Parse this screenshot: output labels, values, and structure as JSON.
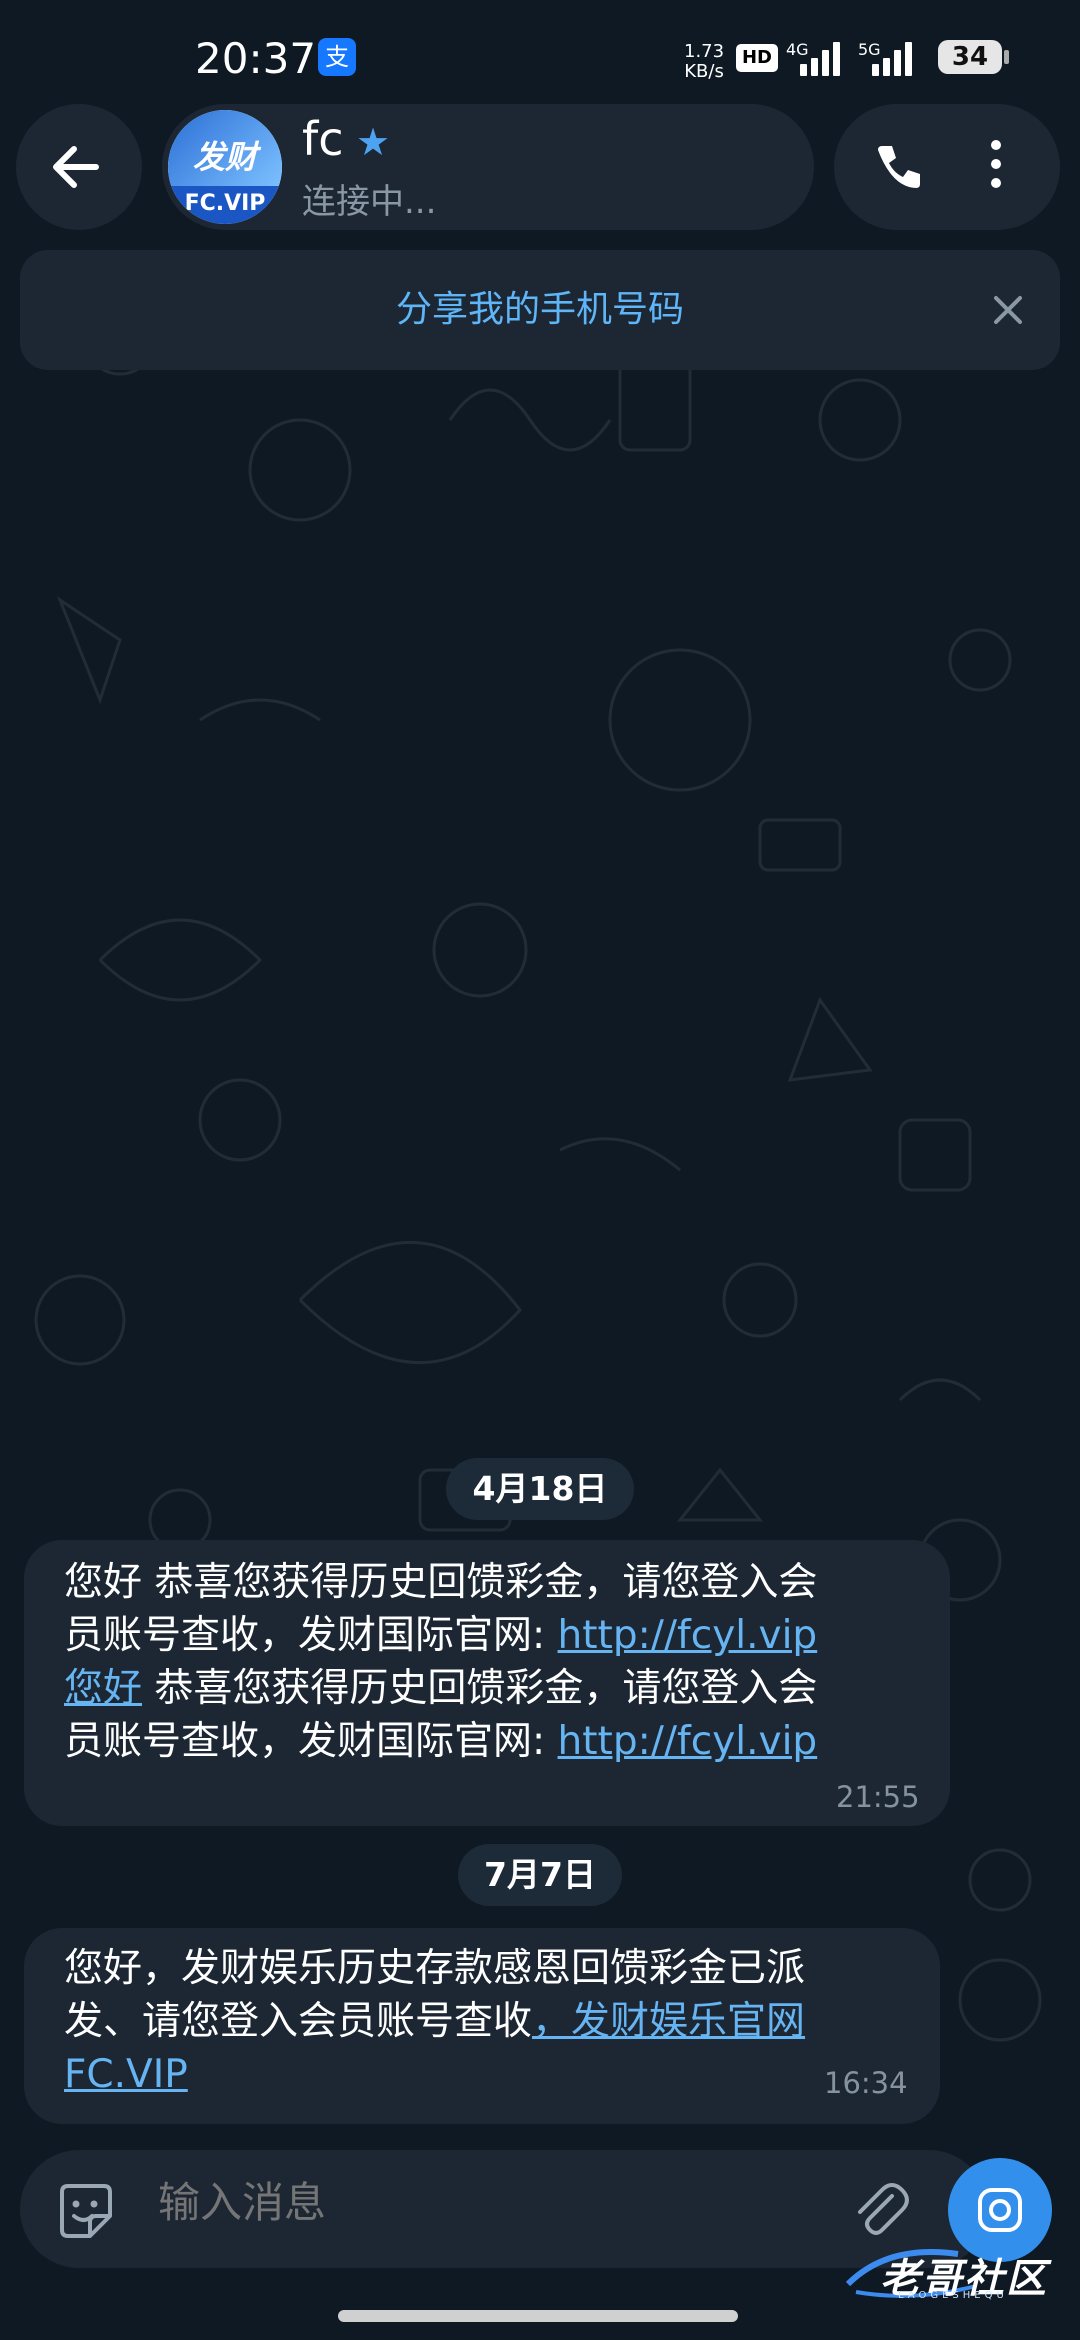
{
  "status_bar": {
    "time": "20:37",
    "alipay_glyph": "支",
    "net_speed_value": "1.73",
    "net_speed_unit": "KB/s",
    "hd_badge": "HD",
    "network_4g": "4G",
    "network_5g": "5G",
    "battery": "34"
  },
  "header": {
    "back_icon": "arrow-left-icon",
    "avatar_script": "发财",
    "avatar_caption": "FC.VIP",
    "chat_name": "fc",
    "status": "连接中...",
    "call_icon": "phone-icon",
    "more_icon": "more-vertical-icon"
  },
  "share_banner": {
    "label": "分享我的手机号码",
    "close_icon": "close-icon"
  },
  "dates": {
    "first": "4月18日",
    "second": "7月7日"
  },
  "messages": [
    {
      "lines": [
        {
          "text": "您好  恭喜您获得历史回馈彩金，请您登入会"
        },
        {
          "text": "员账号查收，发财国际官网:  ",
          "link": "http://fcyl.vip"
        },
        {
          "link_lead": "您好",
          "text": "  恭喜您获得历史回馈彩金，请您登入会"
        },
        {
          "text": "员账号查收，发财国际官网:  ",
          "link": "http://fcyl.vip"
        }
      ],
      "time": "21:55"
    },
    {
      "lines": [
        {
          "text": "您好，发财娱乐历史存款感恩回馈彩金已派"
        },
        {
          "text": "发、请您登入会员账号查收",
          "link": "，发财娱乐官网"
        },
        {
          "link_lead": "FC.VIP"
        }
      ],
      "time": "16:34"
    }
  ],
  "input": {
    "emoji_icon": "sticker-emoji-icon",
    "placeholder": "输入消息",
    "attach_icon": "paperclip-icon",
    "camera_icon": "camera-icon"
  },
  "watermark": {
    "text": "老哥社区",
    "sub": "LAOGESHEQU"
  },
  "colors": {
    "background": "#0f1923",
    "bubble": "#1c2733",
    "accent": "#5eb5f7",
    "link": "#66b4f2",
    "camera_button": "#3290ec"
  }
}
